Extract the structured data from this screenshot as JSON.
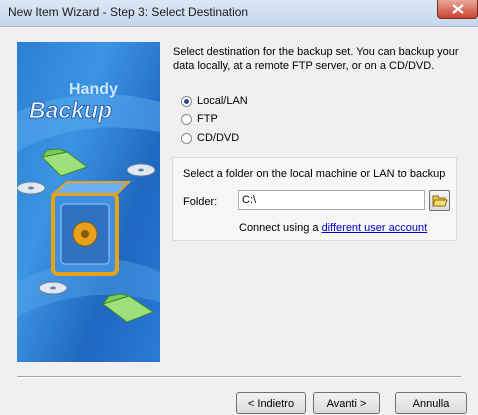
{
  "window": {
    "title": "New Item Wizard - Step 3: Select Destination"
  },
  "banner": {
    "logo_line1": "Handy",
    "logo_line2": "Backup"
  },
  "prompt": "Select destination for the backup set. You can backup your data locally, at a remote FTP server, or on a CD/DVD.",
  "destinations": [
    {
      "label": "Local/LAN",
      "selected": true
    },
    {
      "label": "FTP",
      "selected": false
    },
    {
      "label": "CD/DVD",
      "selected": false
    }
  ],
  "local": {
    "caption": "Select a folder on the local machine or LAN to backup",
    "folder_label": "Folder:",
    "folder_value": "C:\\",
    "connect_prefix": "Connect using a",
    "connect_link": "different user account"
  },
  "buttons": {
    "back": "< Indietro",
    "next": "Avanti >",
    "cancel": "Annulla"
  },
  "colors": {
    "banner_blue": "#2b7fd3",
    "link": "#0000cc",
    "close_red": "#c9452f"
  }
}
